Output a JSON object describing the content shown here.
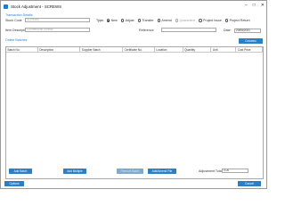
{
  "window": {
    "title": "Stock Adjustment - SCREWS",
    "controls": [
      "minimize-icon",
      "maximize-icon",
      "close-icon"
    ]
  },
  "transaction": {
    "section_label": "Transaction Details",
    "stock_code_label": "Stock Code",
    "stock_code_value": "SCREWS",
    "type_label": "Type:",
    "types": [
      {
        "label": "New",
        "selected": true,
        "enabled": true
      },
      {
        "label": "Adjust",
        "selected": false,
        "enabled": true
      },
      {
        "label": "Transfer",
        "selected": false,
        "enabled": true
      },
      {
        "label": "Amend",
        "selected": false,
        "enabled": true
      },
      {
        "label": "Quarantine",
        "selected": false,
        "enabled": false
      },
      {
        "label": "Project Issue",
        "selected": false,
        "enabled": true
      },
      {
        "label": "Project Return",
        "selected": false,
        "enabled": true
      }
    ],
    "item_description_label": "Item Description",
    "item_description_value": "Countersunk Screws",
    "reference_label": "Reference",
    "reference_value": "",
    "date_label": "Date:",
    "date_value": "23/06/2021"
  },
  "online_batches": {
    "section_label": "Online Batches",
    "columns_button": "Columns",
    "columns": [
      "Batch No.",
      "Description",
      "Supplier Batch",
      "Certificate No.",
      "Location",
      "Quantity",
      "Unit",
      "Cost Price"
    ],
    "rows": []
  },
  "footer": {
    "add_batch": "Add Batch",
    "add_multiple": "Add Multiple",
    "remove_batch": "Remove Batch",
    "add_from_file": "Add/Amend File",
    "adjustment_total_label": "Adjustment Total:",
    "adjustment_total_value": "0.00",
    "options_button": "Options",
    "cancel_button": "Cancel"
  },
  "colors": {
    "accent": "#2b7fc6",
    "section_label": "#2f7ec7",
    "disabled_button": "#7fa9cf"
  }
}
